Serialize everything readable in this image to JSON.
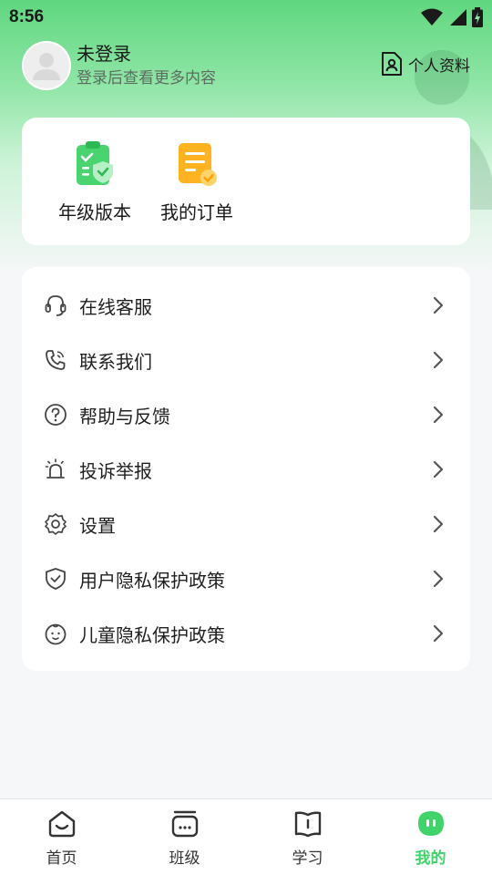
{
  "status_bar": {
    "time": "8:56"
  },
  "profile": {
    "name": "未登录",
    "subtitle": "登录后查看更多内容",
    "link_label": "个人资料"
  },
  "quick_actions": [
    {
      "label": "年级版本",
      "icon": "clipboard-shield-icon"
    },
    {
      "label": "我的订单",
      "icon": "order-document-icon"
    }
  ],
  "menu": [
    {
      "label": "在线客服",
      "icon": "headset-icon"
    },
    {
      "label": "联系我们",
      "icon": "phone-icon"
    },
    {
      "label": "帮助与反馈",
      "icon": "help-circle-icon"
    },
    {
      "label": "投诉举报",
      "icon": "alarm-icon"
    },
    {
      "label": "设置",
      "icon": "gear-icon"
    },
    {
      "label": "用户隐私保护政策",
      "icon": "shield-check-icon"
    },
    {
      "label": "儿童隐私保护政策",
      "icon": "child-face-icon"
    }
  ],
  "bottom_nav": [
    {
      "label": "首页",
      "icon": "home-icon",
      "active": false
    },
    {
      "label": "班级",
      "icon": "class-icon",
      "active": false
    },
    {
      "label": "学习",
      "icon": "book-icon",
      "active": false
    },
    {
      "label": "我的",
      "icon": "me-icon",
      "active": true
    }
  ],
  "colors": {
    "accent": "#3fd36a",
    "header_green": "#5fd77f"
  }
}
